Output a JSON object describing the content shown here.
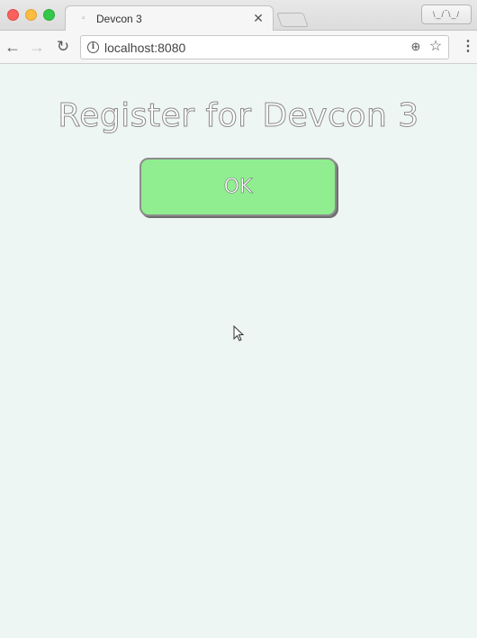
{
  "browser": {
    "tab": {
      "title": "Devcon 3",
      "close_glyph": "✕"
    },
    "profile_button_label": "\\_/‾\\_/",
    "toolbar": {
      "back_glyph": "←",
      "forward_glyph": "→",
      "reload_glyph": "↻",
      "url": "localhost:8080",
      "info_glyph": "i",
      "zoom_glyph": "⊕",
      "star_glyph": "☆",
      "menu_glyph": "⋮"
    },
    "icons": {
      "close": "close-icon",
      "minimize": "minimize-icon",
      "maximize": "maximize-icon",
      "info": "info-icon",
      "zoom": "zoom-icon",
      "bookmark": "star-icon",
      "menu": "menu-icon",
      "cursor": "cursor-icon"
    }
  },
  "page": {
    "title": "Register for Devcon 3",
    "ok_button_label": "OK",
    "ok_button_color": "#90ee90",
    "background_color": "#eef6f4"
  }
}
